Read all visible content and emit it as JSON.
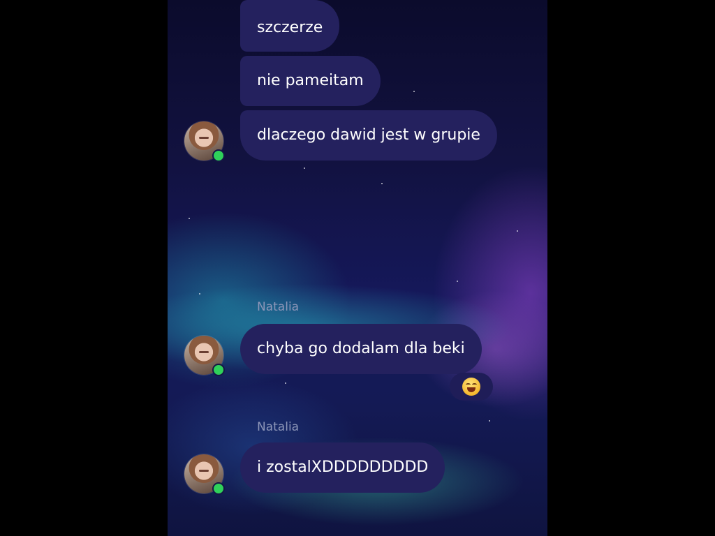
{
  "messages": [
    {
      "text": "szczerze"
    },
    {
      "text": "nie pameitam"
    },
    {
      "text": "dlaczego dawid jest w grupie"
    },
    {
      "sender": "Natalia",
      "text": "chyba go dodalam dla beki",
      "reaction": "laughing-face-emoji"
    },
    {
      "sender": "Natalia",
      "text": "i zostalXDDDDDDDDD"
    }
  ],
  "colors": {
    "bubble": "#24215e",
    "online": "#2fd15a",
    "sender_label": "#8d96b8"
  },
  "icons": {
    "avatar": "avatar",
    "online_status": "online-dot-icon",
    "reaction": "laughing-face-emoji"
  }
}
